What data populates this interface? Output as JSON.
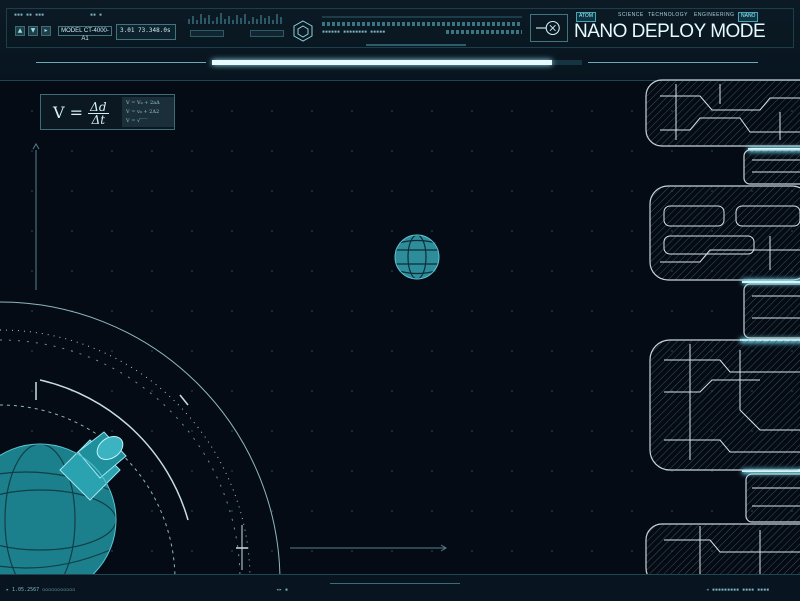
{
  "header": {
    "model_label": "MODEL CT-4000-A1",
    "readout_value": "3.01 73.348.0s",
    "nav_tags": [
      "ATOM",
      "NANO"
    ],
    "nav_items": [
      "SCIENCE",
      "TECHNOLOGY",
      "ENGINEERING"
    ],
    "title": "NANO DEPLOY MODE",
    "progress_fraction": 0.92
  },
  "formula": {
    "lhs": "V",
    "numerator": "Δd",
    "denominator": "Δt",
    "side_lines": [
      "V = V₀ + 2aΔ",
      "V = v₀ + 2Δ2",
      "V = √‾‾‾"
    ]
  },
  "footer": {
    "left_code": "1.05.2567"
  },
  "colors": {
    "background": "#050b15",
    "accent": "#4fb7c4",
    "glow": "#6fe7ff",
    "title": "#e6fbff"
  },
  "icons": [
    "hexagon-icon",
    "lens-icon",
    "globe-icon",
    "atom-sphere-icon",
    "circuit-chip-icon"
  ]
}
